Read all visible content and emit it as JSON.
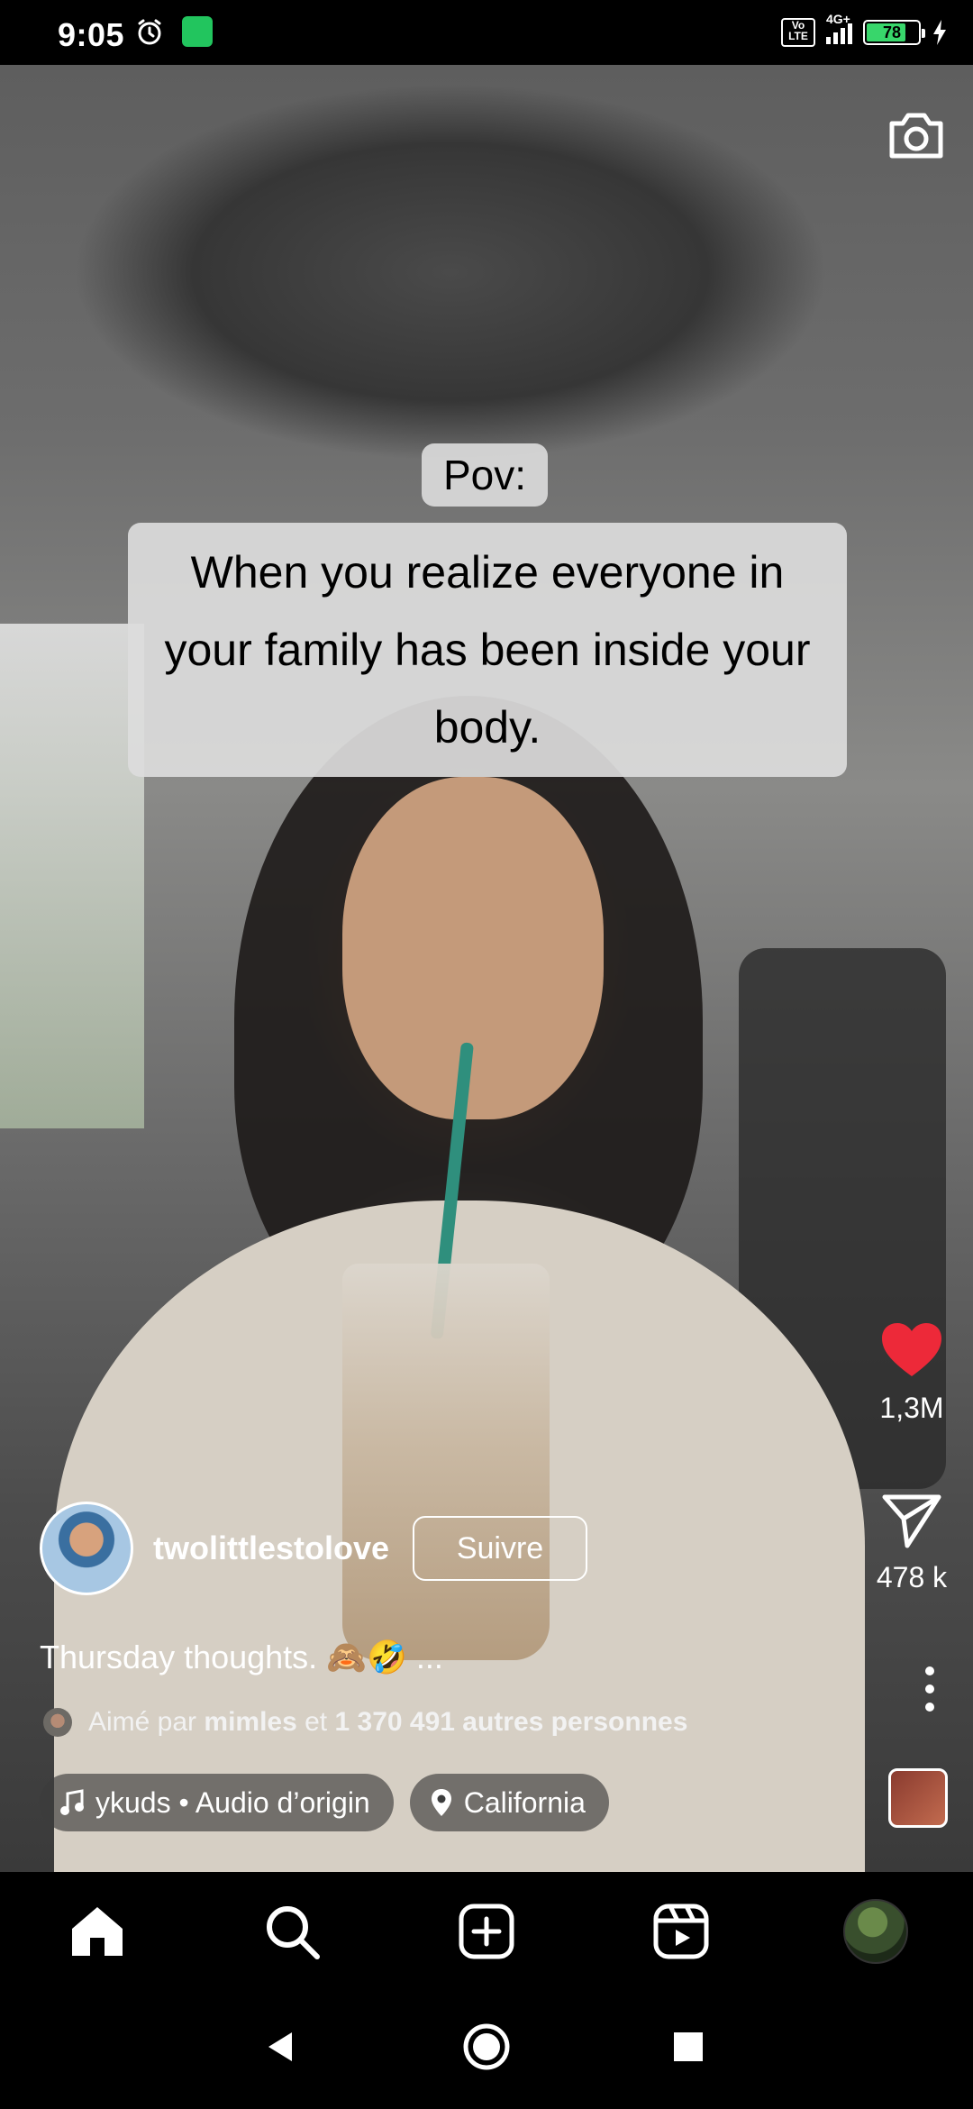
{
  "status_bar": {
    "time": "9:05",
    "network": "4G+",
    "volte": "Vo LTE",
    "battery_percent": "78",
    "battery_level": 0.78,
    "accent_green": "#38d66b"
  },
  "reel": {
    "caption_top": "Pov:",
    "caption_main": "When you realize everyone in your family has been inside your body.",
    "likes_count": "1,3M",
    "shares_count": "478 k",
    "like_color": "#ed2939"
  },
  "author": {
    "username": "twolittlestolove",
    "follow_label": "Suivre"
  },
  "post": {
    "caption": "Thursday thoughts. 🙈🤣 ...",
    "likes_prefix": "Aimé par",
    "likes_user": "mimles",
    "likes_et": "et",
    "likes_others": "1 370 491 autres personnes"
  },
  "chips": {
    "audio": "ykuds • Audio d’origin",
    "location": "California"
  },
  "icons": {
    "camera": "camera-icon",
    "heart": "heart-icon",
    "share": "send-icon",
    "more": "more-vertical-icon",
    "home": "home-icon",
    "search": "search-icon",
    "create": "plus-square-icon",
    "reels": "reels-icon"
  }
}
